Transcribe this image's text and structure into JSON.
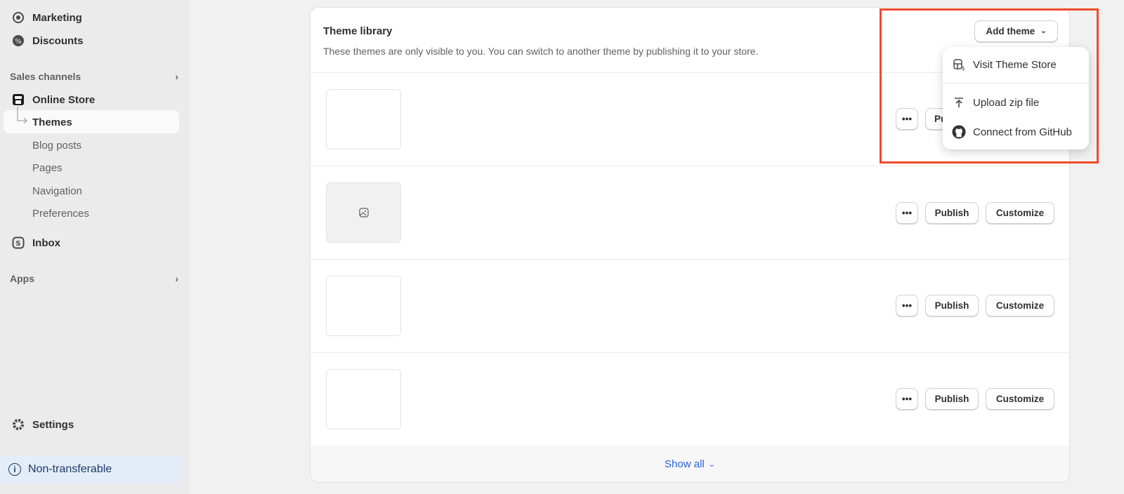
{
  "sidebar": {
    "items": [
      {
        "label": "Marketing",
        "icon": "target-icon"
      },
      {
        "label": "Discounts",
        "icon": "discount-icon"
      }
    ],
    "sales_channels": "Sales channels",
    "online_store": "Online Store",
    "sub_items": [
      "Themes",
      "Blog posts",
      "Pages",
      "Navigation",
      "Preferences"
    ],
    "inbox": "Inbox",
    "apps": "Apps",
    "settings": "Settings",
    "non_transferable": "Non-transferable"
  },
  "card": {
    "title": "Theme library",
    "description": "These themes are only visible to you. You can switch to another theme by publishing it to your store.",
    "add_theme": "Add theme",
    "publish": "Publish",
    "customize": "Customize",
    "publish_partial": "Pu",
    "show_all": "Show all"
  },
  "menu": {
    "items": [
      "Visit Theme Store",
      "Upload zip file",
      "Connect from GitHub"
    ]
  },
  "colors": {
    "highlight": "#ef4a2b",
    "link": "#2b63d9"
  }
}
